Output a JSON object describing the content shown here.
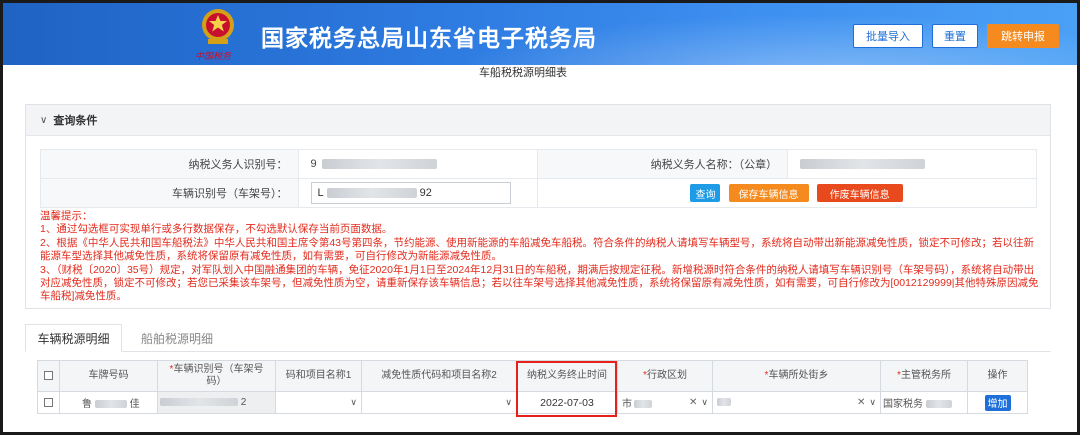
{
  "header": {
    "site_title": "国家税务总局山东省电子税务局",
    "emblem_script": "中国税务",
    "buttons": {
      "import": "批量导入",
      "reset": "重置",
      "jump": "跳转申报"
    }
  },
  "page_title": "车船税税源明细表",
  "query": {
    "title": "查询条件",
    "taxpayer_id_label": "纳税义务人识别号：",
    "taxpayer_id_value": "9",
    "taxpayer_name_label": "纳税义务人名称：（公章）",
    "taxpayer_name_value": "",
    "vin_label": "车辆识别号（车架号）：",
    "vin_value": "L",
    "vin_value_tail": "92",
    "btn_query": "查询",
    "btn_save": "保存车辆信息",
    "btn_void": "作废车辆信息"
  },
  "tips": {
    "heading": "温馨提示：",
    "line1": "1、通过勾选框可实现单行或多行数据保存，不勾选默认保存当前页面数据。",
    "line2": "2、根据《中华人民共和国车船税法》中华人民共和国主席令第43号第四条，节约能源、使用新能源的车船减免车船税。符合条件的纳税人请填写车辆型号，系统将自动带出新能源减免性质，锁定不可修改；若以往新能源车型选择其他减免性质，系统将保留原有减免性质，如有需要，可自行修改为新能源减免性质。",
    "line3": "3、（财税〔2020〕35号）规定，对军队划入中国融通集团的车辆，免征2020年1月1日至2024年12月31日的车船税，期满后按规定征税。新增税源时符合条件的纳税人请填写车辆识别号（车架号码），系统将自动带出对应减免性质，锁定不可修改；若您已采集该车架号，但减免性质为空，请重新保存该车辆信息；若以往车架号选择其他减免性质，系统将保留原有减免性质，如有需要，可自行修改为[0012129999|其他特殊原因减免车船税]减免性质。"
  },
  "tabs": {
    "vehicle": "车辆税源明细",
    "ship": "船舶税源明细"
  },
  "table": {
    "headers": {
      "plate": "车牌号码",
      "vin_l1": "车辆识别号（车架号",
      "vin_l2": "码）",
      "code1": "码和项目名称1",
      "code2": "减免性质代码和项目名称2",
      "end_time": "纳税义务终止时间",
      "district": "行政区划",
      "street": "车辆所处街乡",
      "authority": "主管税务所",
      "ops": "操作"
    },
    "row": {
      "plate": "鲁",
      "plate_tail": "佳",
      "vin_tail": "2",
      "end_time": "2022-07-03",
      "district": "市",
      "street": "",
      "authority": "国家税务",
      "add_btn": "增加"
    }
  }
}
